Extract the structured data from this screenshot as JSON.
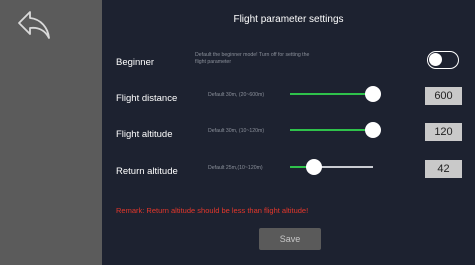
{
  "header": {
    "title": "Flight parameter settings"
  },
  "back": {
    "icon": "back-arrow-icon"
  },
  "beginner": {
    "label": "Beginner",
    "hint_line1": "Default the beginner mode! Turn off for setting the",
    "hint_line2": "flight parameter",
    "toggle_on": false
  },
  "distance": {
    "label": "Flight distance",
    "hint": "Default 30m, (20~600m)",
    "value": "600",
    "slider_fraction": 1.0
  },
  "altitude": {
    "label": "Flight altitude",
    "hint": "Default 30m, (10~120m)",
    "value": "120",
    "slider_fraction": 1.0
  },
  "return_altitude": {
    "label": "Return altitude",
    "hint": "Default 25m,(10~120m)",
    "value": "42",
    "slider_fraction": 0.29
  },
  "remark": "Remark: Return altitude should be less than flight altitude!",
  "save_label": "Save",
  "colors": {
    "accent": "#2fc24b",
    "warning": "#e4372b",
    "panel_bg": "#1d2230",
    "sidebar_bg": "#5b5b5b"
  }
}
